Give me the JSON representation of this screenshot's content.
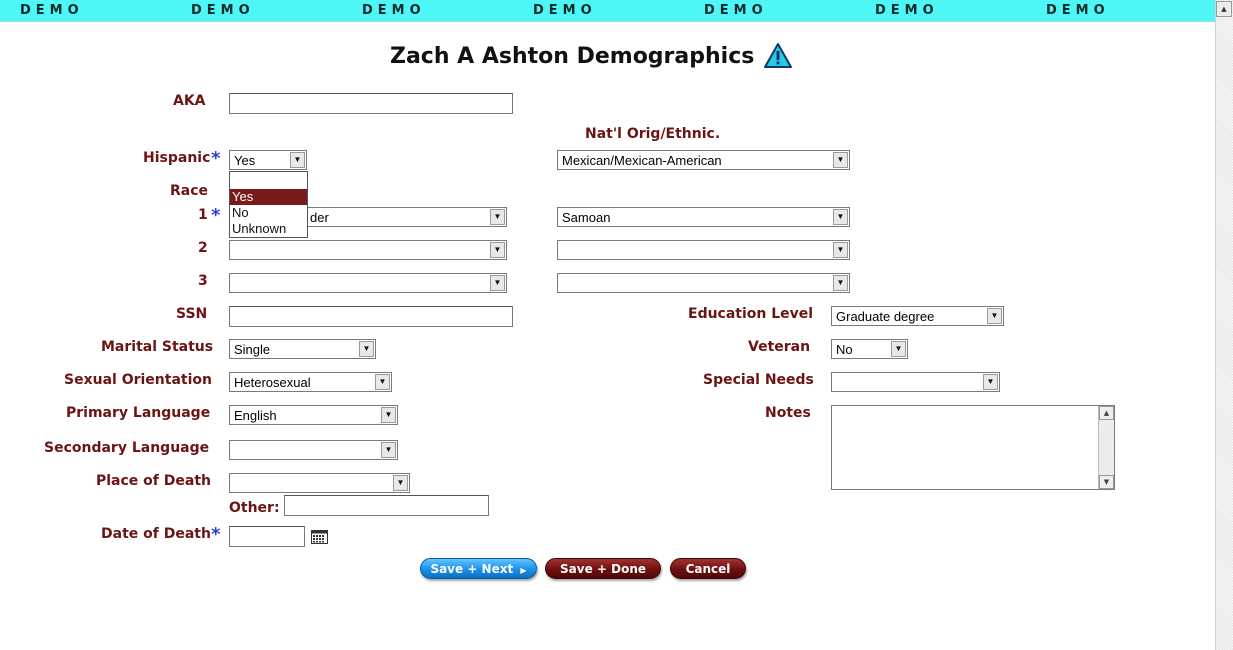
{
  "banner": {
    "word": "DEMO",
    "count": 7
  },
  "page": {
    "title": "Zach A Ashton Demographics",
    "warning_icon": "warning-triangle-icon"
  },
  "labels": {
    "aka": "AKA",
    "hispanic": "Hispanic",
    "race": "Race",
    "race1": "1",
    "race2": "2",
    "race3": "3",
    "natl_orig": "Nat'l Orig/Ethnic.",
    "ssn": "SSN",
    "marital": "Marital Status",
    "sexual": "Sexual Orientation",
    "primary_lang": "Primary Language",
    "secondary_lang": "Secondary Language",
    "place_death": "Place of Death",
    "other": "Other:",
    "date_death": "Date of Death",
    "education": "Education Level",
    "veteran": "Veteran",
    "special": "Special Needs",
    "notes": "Notes",
    "required_mark": "*"
  },
  "values": {
    "aka": "",
    "hispanic": "Yes",
    "natl_orig": "Mexican/Mexican-American",
    "race1_partial": "der",
    "race1_orig": "Samoan",
    "race2": "",
    "race2_orig": "",
    "race3": "",
    "race3_orig": "",
    "ssn": "",
    "marital": "Single",
    "sexual": "Heterosexual",
    "primary_lang": "English",
    "secondary_lang": "",
    "place_death": "",
    "other": "",
    "date_death": "",
    "education": "Graduate degree",
    "veteran": "No",
    "special": "",
    "notes": ""
  },
  "hispanic_dropdown": {
    "options": [
      "",
      "Yes",
      "No",
      "Unknown"
    ],
    "highlighted": "Yes"
  },
  "buttons": {
    "save_next": "Save + Next",
    "save_done": "Save + Done",
    "cancel": "Cancel"
  },
  "colors": {
    "banner": "#4ef6f6",
    "label": "#6b1414",
    "required": "#2b3fd6",
    "blue_button": "#1b8fe8",
    "red_button": "#6e0f0f",
    "highlight": "#7a1a1a"
  }
}
